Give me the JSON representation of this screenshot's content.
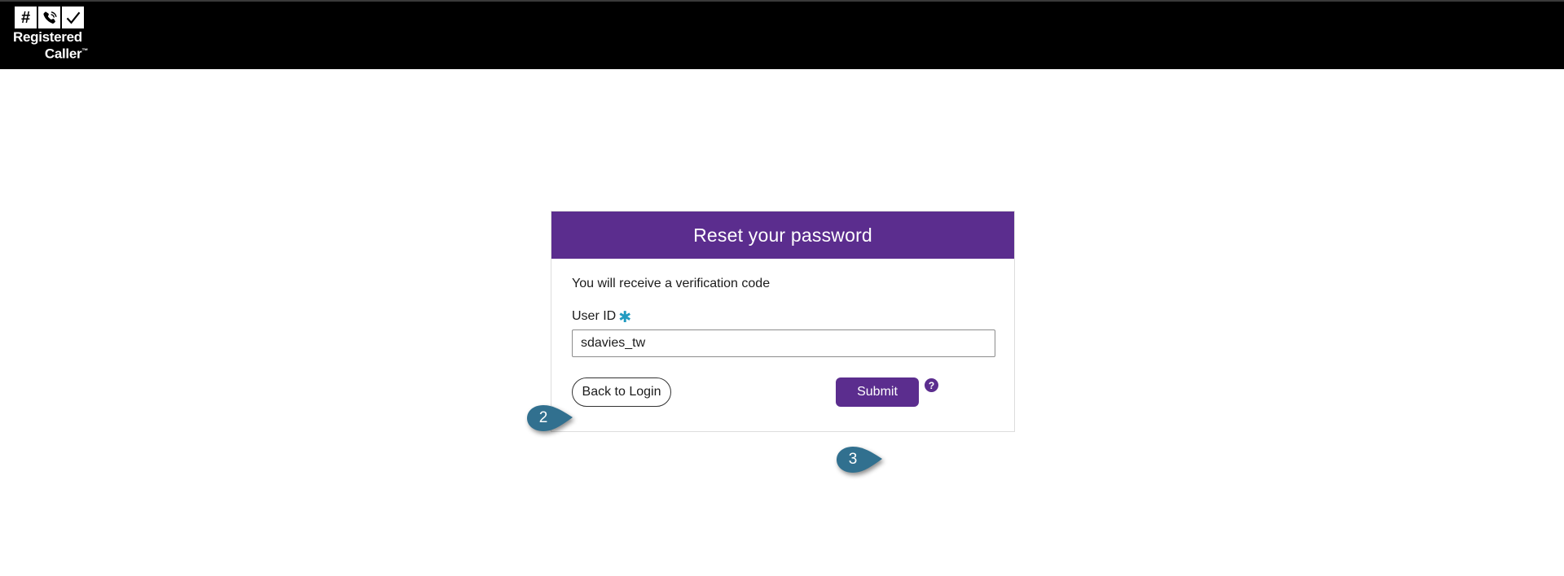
{
  "brand": {
    "logo_tiles": [
      "#",
      "phone-waves-icon",
      "checkmark-icon"
    ],
    "name_line1": "Registered",
    "name_line2": "Caller",
    "trademark": "™",
    "bar_color": "#000000"
  },
  "card": {
    "title": "Reset your password",
    "header_color": "#5b2d8e",
    "intro": "You will receive a verification code",
    "field": {
      "label": "User ID",
      "required_marker": "✱",
      "required_color": "#1f9ac0",
      "value": "sdavies_tw",
      "placeholder": ""
    },
    "buttons": {
      "back_label": "Back to Login",
      "submit_label": "Submit",
      "submit_color": "#5b2d8e"
    },
    "help_icon_label": "?"
  },
  "callouts": [
    {
      "number": "2",
      "color": "#31708f",
      "target": "user-id-input"
    },
    {
      "number": "3",
      "color": "#31708f",
      "target": "submit-button"
    }
  ]
}
